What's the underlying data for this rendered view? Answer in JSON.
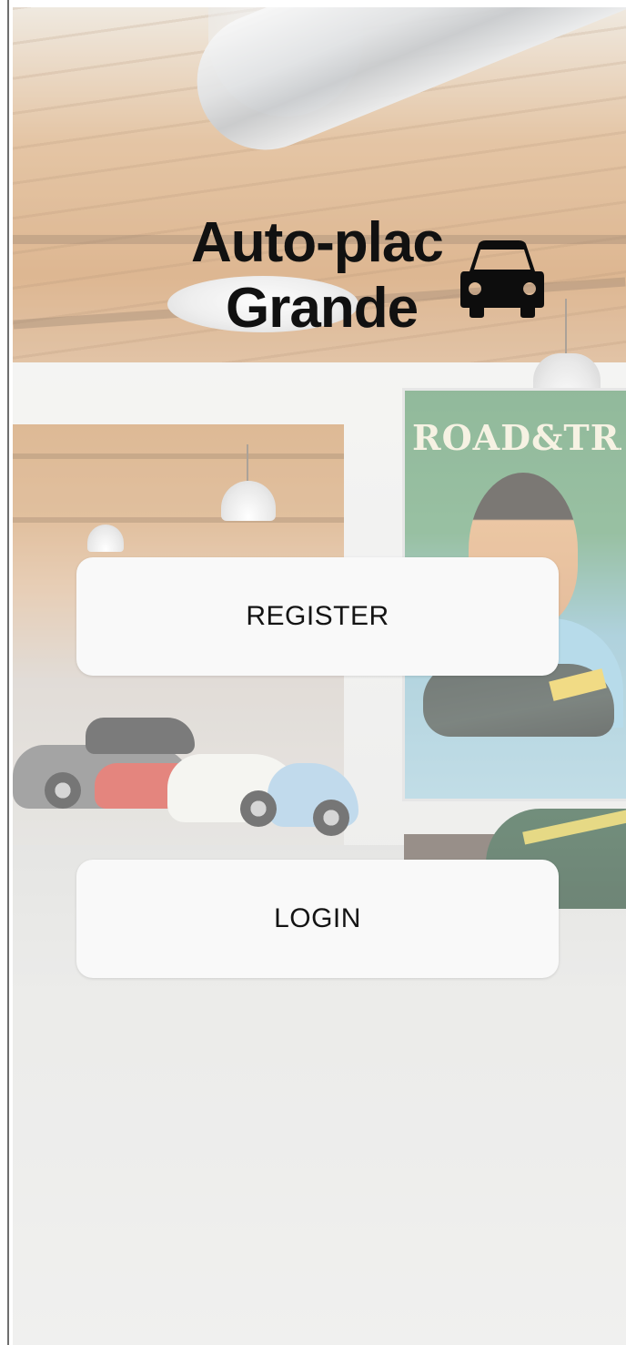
{
  "app": {
    "brand_line1": "Auto-plac",
    "brand_line2": "Grande",
    "brand_icon": "car-icon"
  },
  "background": {
    "poster_text": "ROAD&TRACK"
  },
  "actions": {
    "register_label": "REGISTER",
    "login_label": "LOGIN"
  },
  "colors": {
    "button_bg": "#f9f9f9",
    "button_text": "#141414",
    "brand_text": "#111111"
  }
}
